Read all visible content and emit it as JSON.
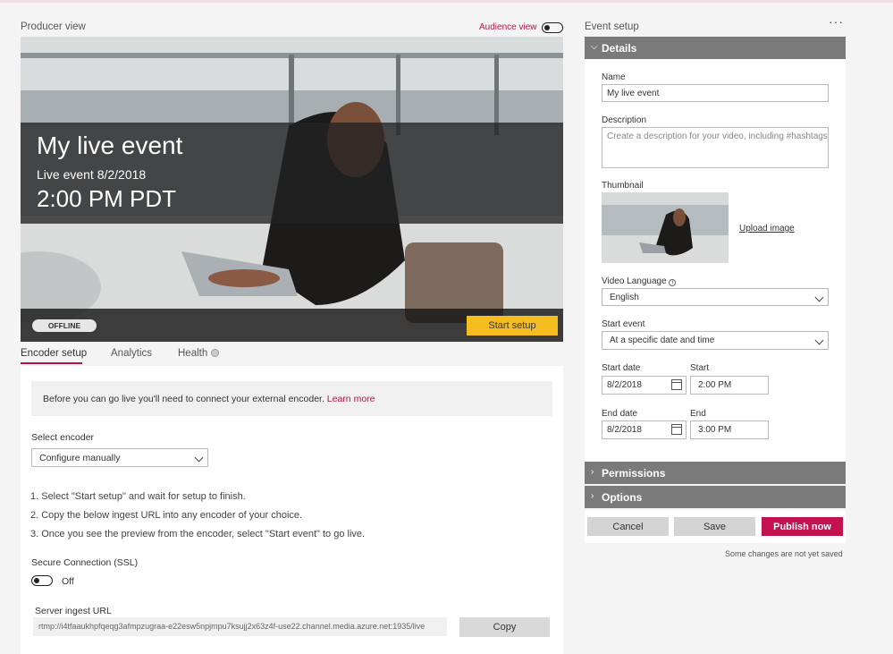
{
  "producer": {
    "title": "Producer view",
    "audience_toggle_label": "Audience view",
    "event_title": "My live event",
    "event_subtitle": "Live event 8/2/2018",
    "event_time": "2:00 PM PDT",
    "status_badge": "OFFLINE",
    "start_setup_label": "Start setup"
  },
  "tabs": [
    {
      "label": "Encoder setup",
      "active": true
    },
    {
      "label": "Analytics",
      "active": false
    },
    {
      "label": "Health",
      "active": false
    }
  ],
  "encoder": {
    "notice_text": "Before you can go live you'll need to connect your external encoder.",
    "notice_link": "Learn more",
    "select_label": "Select encoder",
    "select_value": "Configure manually",
    "steps": [
      "1.  Select \"Start setup\" and wait for setup to finish.",
      "2.  Copy the below ingest URL into any encoder of your choice.",
      "3.  Once you see the preview from the encoder, select \"Start event\" to go live."
    ],
    "ssl_label": "Secure Connection (SSL)",
    "ssl_state": "Off",
    "url_label": "Server ingest URL",
    "url_value": "rtmp://i4tfaaukhpfqeqg3afmpzugraa-e22esw5npjmpu7ksujj2x63z4f-use22.channel.media.azure.net:1935/live",
    "copy_label": "Copy"
  },
  "event_setup": {
    "title": "Event setup",
    "more_label": "···",
    "details_header": "Details",
    "name_label": "Name",
    "name_value": "My live event",
    "description_label": "Description",
    "description_placeholder": "Create a description for your video, including #hashtags",
    "thumbnail_label": "Thumbnail",
    "upload_label": "Upload image",
    "language_label": "Video Language",
    "language_value": "English",
    "start_event_label": "Start event",
    "start_event_value": "At a specific date and time",
    "start_date_label": "Start date",
    "start_date_value": "8/2/2018",
    "start_time_label": "Start",
    "start_time_value": "2:00 PM",
    "end_date_label": "End date",
    "end_date_value": "8/2/2018",
    "end_time_label": "End",
    "end_time_value": "3:00 PM",
    "permissions_header": "Permissions",
    "options_header": "Options",
    "cancel_label": "Cancel",
    "save_label": "Save",
    "publish_label": "Publish now",
    "unsaved_note": "Some changes are not yet saved"
  },
  "colors": {
    "accent": "#b0154f",
    "publish": "#c4114f",
    "start_setup": "#f5bd1f",
    "section_header": "#7a7a7a"
  }
}
